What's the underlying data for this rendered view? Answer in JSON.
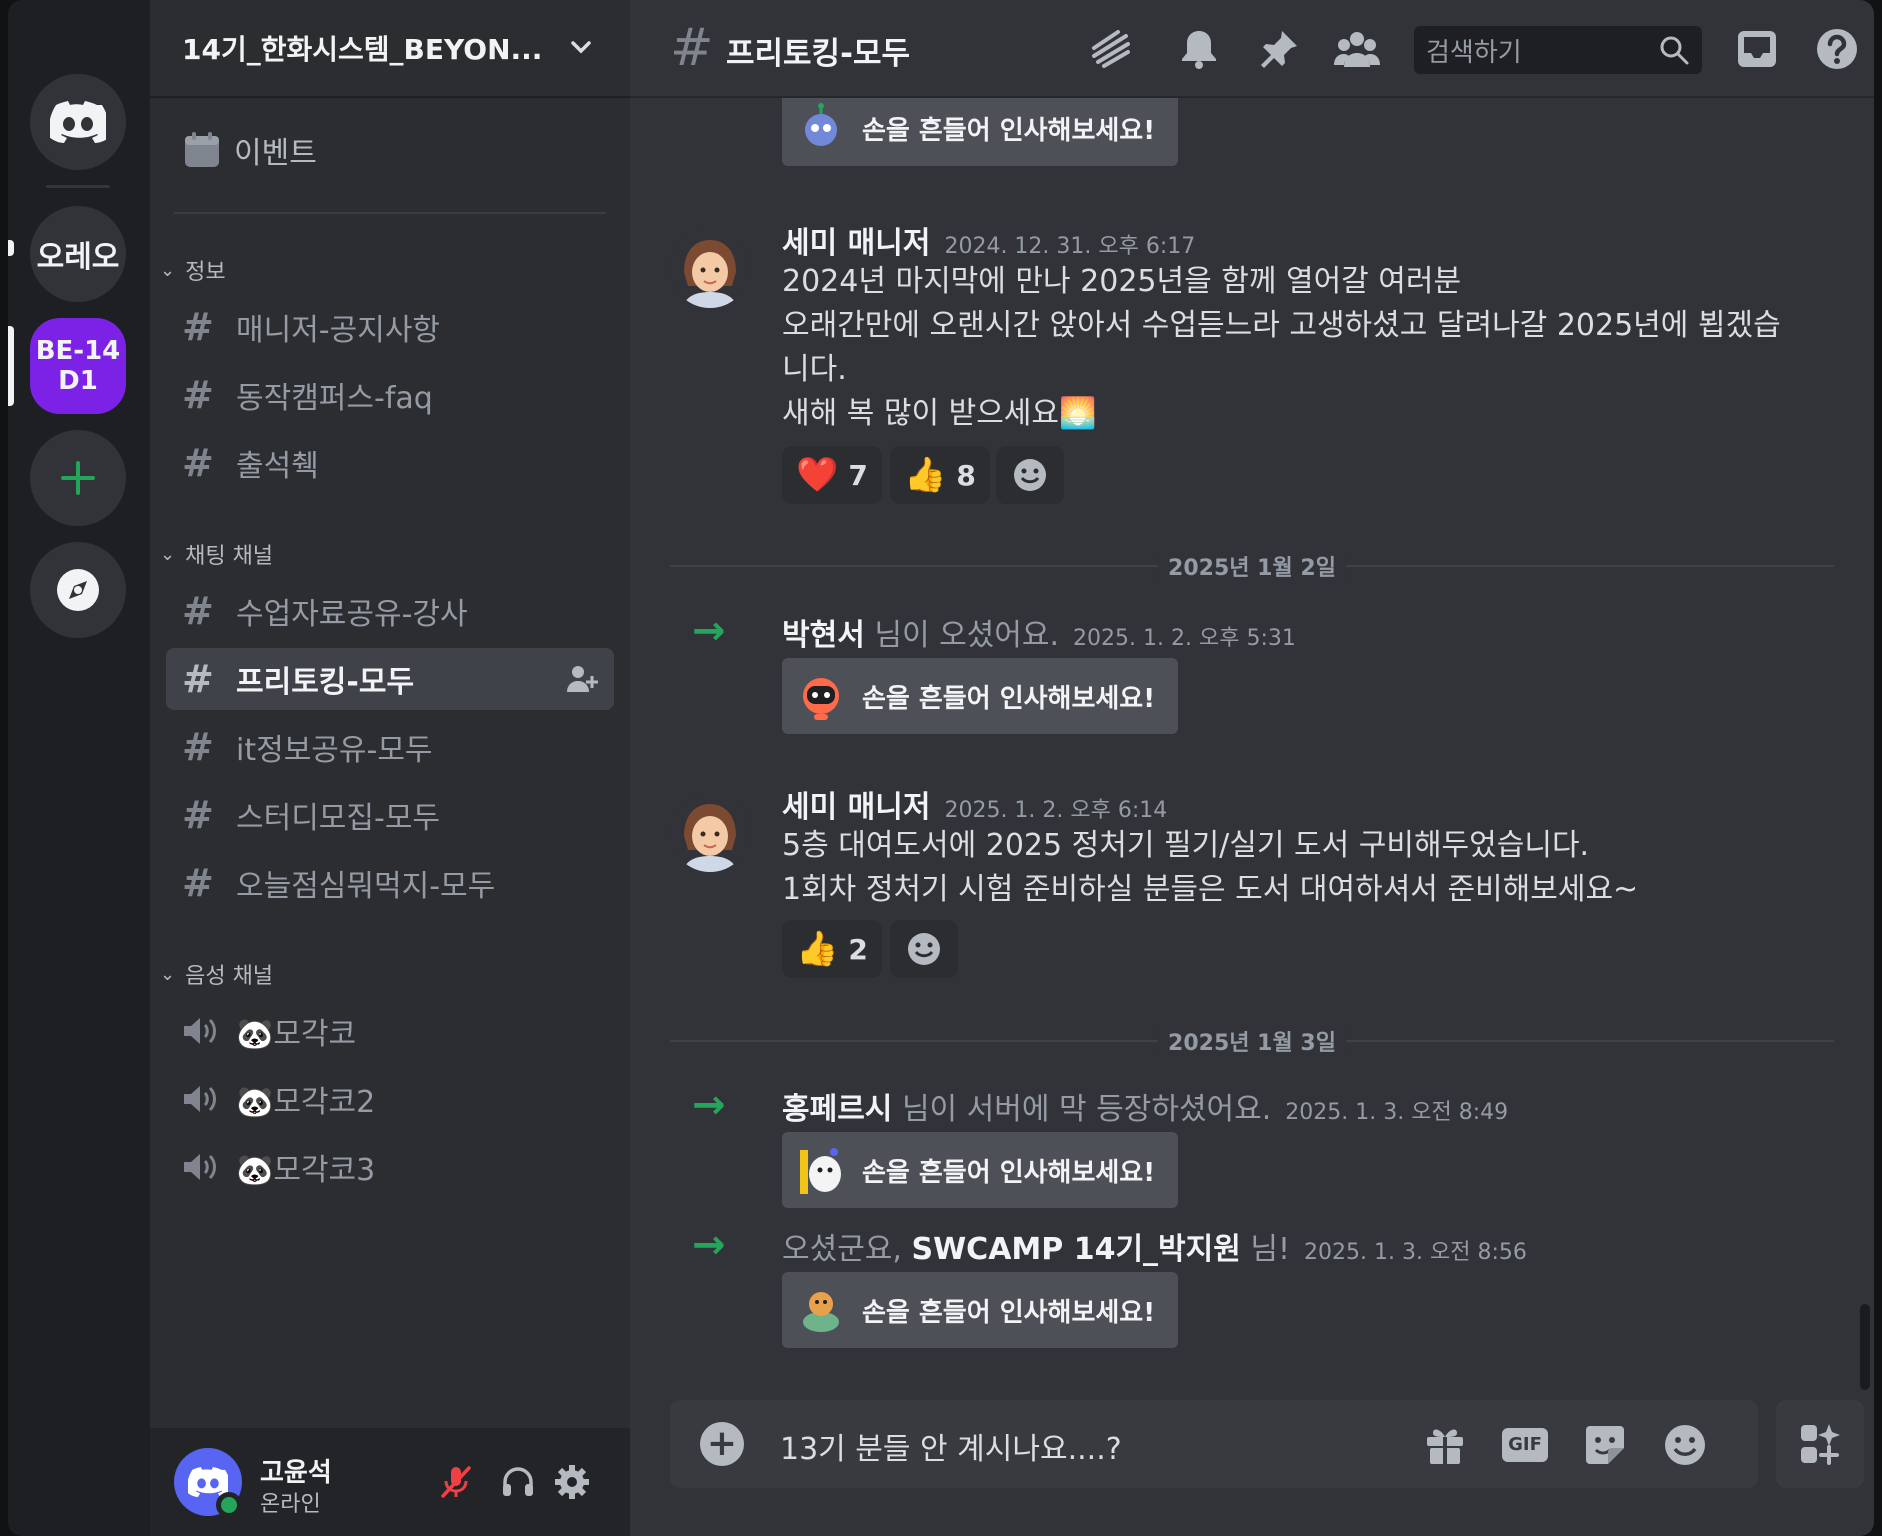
{
  "server_rail": {
    "servers": [
      {
        "name": "discord-home",
        "label": ""
      },
      {
        "name": "server-orello",
        "label": "오레오"
      },
      {
        "name": "server-be14",
        "label": "BE-14\nD1"
      }
    ]
  },
  "sidebar": {
    "guild_name": "14기_한화시스템_BEYON...",
    "events_label": "이벤트",
    "categories": [
      {
        "label": "정보",
        "channels": [
          "매니저-공지사항",
          "동작캠퍼스-faq",
          "출석췍"
        ]
      },
      {
        "label": "채팅 채널",
        "channels": [
          "수업자료공유-강사",
          "프리토킹-모두",
          "it정보공유-모두",
          "스터디모집-모두",
          "오늘점심뭐먹지-모두"
        ]
      },
      {
        "label": "음성 채널",
        "channels": [
          "🐼모각코",
          "🐼모각코2",
          "🐼모각코3"
        ]
      }
    ],
    "active_channel": "프리토킹-모두"
  },
  "user": {
    "name": "고윤석",
    "status": "온라인"
  },
  "topbar": {
    "channel_name": "프리토킹-모두",
    "search_placeholder": "검색하기"
  },
  "messages": {
    "wave_label": "손을 흔들어 인사해보세요!",
    "m1": {
      "author": "세미 매니저",
      "timestamp": "2024. 12. 31. 오후 6:17",
      "lines": [
        "2024년 마지막에 만나 2025년을 함께 열어갈 여러분",
        "오래간만에 오랜시간 앉아서 수업듣느라 고생하셨고 달려나갈 2025년에 뵙겠습",
        "니다.",
        "새해 복 많이 받으세요🌅"
      ],
      "reactions": [
        {
          "emoji": "❤️",
          "count": "7"
        },
        {
          "emoji": "👍",
          "count": "8"
        }
      ]
    },
    "divider1": "2025년 1월 2일",
    "j1": {
      "user": "박현서",
      "text": " 님이 오셨어요.",
      "timestamp": "2025. 1. 2. 오후 5:31"
    },
    "m2": {
      "author": "세미 매니저",
      "timestamp": "2025. 1. 2. 오후 6:14",
      "lines": [
        "5층 대여도서에 2025 정처기 필기/실기 도서 구비해두었습니다.",
        "1회차 정처기 시험 준비하실 분들은 도서 대여하셔서 준비해보세요~"
      ],
      "reactions": [
        {
          "emoji": "👍",
          "count": "2"
        }
      ]
    },
    "divider2": "2025년 1월 3일",
    "j2": {
      "user": "홍페르시",
      "text": " 님이 서버에 막 등장하셨어요.",
      "timestamp": "2025. 1. 3. 오전 8:49"
    },
    "j3": {
      "prefix": "오셨군요, ",
      "user": "SWCAMP 14기_박지원",
      "suffix": " 님!",
      "timestamp": "2025. 1. 3. 오전 8:56"
    }
  },
  "composer": {
    "draft": "13기 분들 안 계시나요....?",
    "gif_label": "GIF"
  },
  "colors": {
    "accent": "#5865f2",
    "online": "#23a55a",
    "server_be14": "#7c22e6"
  },
  "icons": [
    "discord-icon",
    "calendar-icon",
    "hash-icon",
    "speaker-icon",
    "mute-mic-icon",
    "headset-icon",
    "gear-icon",
    "threads-icon",
    "bell-icon",
    "pin-icon",
    "members-icon",
    "search-icon",
    "inbox-icon",
    "help-icon",
    "gift-icon",
    "gif-icon",
    "sticker-icon",
    "emoji-icon",
    "apps-icon",
    "add-reaction-icon",
    "plus-icon",
    "add-member-icon",
    "compass-icon"
  ]
}
